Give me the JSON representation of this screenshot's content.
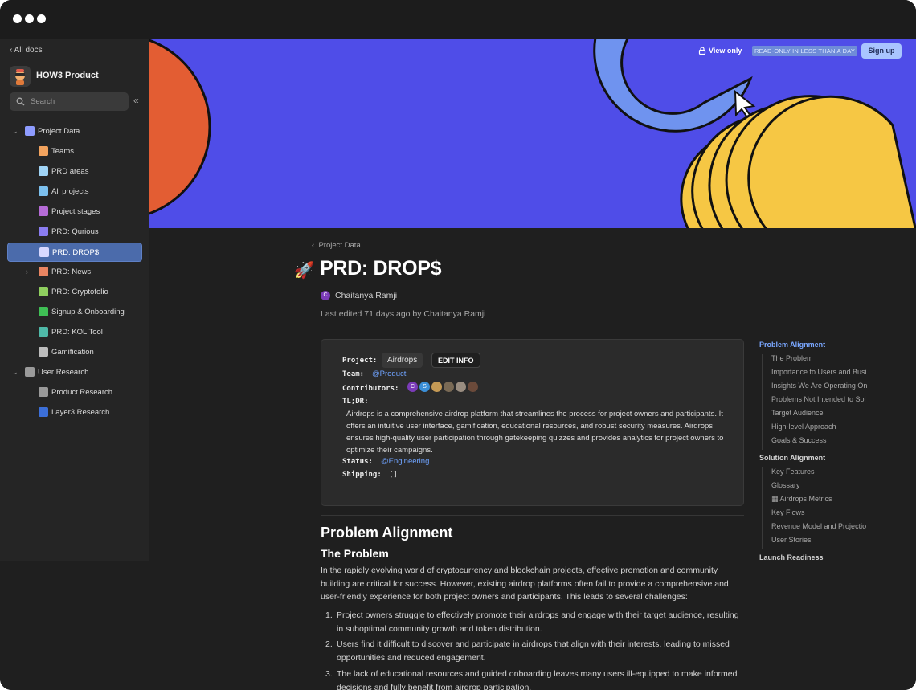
{
  "sidebar": {
    "back_label": "‹ All docs",
    "workspace_name": "HOW3 Product",
    "search_placeholder": "Search",
    "collapse_glyph": "«",
    "items": [
      {
        "label": "Project Data",
        "icon": "database-icon",
        "chev": "⌄",
        "level": 0,
        "color": "#8e9cff"
      },
      {
        "label": "Teams",
        "icon": "people-icon",
        "chev": "",
        "level": 1,
        "color": "#f2a35e"
      },
      {
        "label": "PRD areas",
        "icon": "document-icon",
        "chev": "",
        "level": 1,
        "color": "#9fd3f5"
      },
      {
        "label": "All projects",
        "icon": "folder-icon",
        "chev": "",
        "level": 1,
        "color": "#7cc0ee"
      },
      {
        "label": "Project stages",
        "icon": "stages-icon",
        "chev": "",
        "level": 1,
        "color": "#b56bd6"
      },
      {
        "label": "PRD: Qurious",
        "icon": "phone-icon",
        "chev": "",
        "level": 1,
        "color": "#8a7cf0"
      },
      {
        "label": "PRD: DROP$",
        "icon": "pen-icon",
        "chev": "",
        "level": 1,
        "color": "#d8d8ff"
      },
      {
        "label": "PRD: News",
        "icon": "newspaper-icon",
        "chev": "›",
        "level": 1,
        "color": "#e98562"
      },
      {
        "label": "PRD: Cryptofolio",
        "icon": "moneybag-icon",
        "chev": "",
        "level": 1,
        "color": "#8fcf5f"
      },
      {
        "label": "Signup & Onboarding",
        "icon": "check-icon",
        "chev": "",
        "level": 1,
        "color": "#3fbf55"
      },
      {
        "label": "PRD: KOL Tool",
        "icon": "globe-icon",
        "chev": "",
        "level": 1,
        "color": "#4fb9a8"
      },
      {
        "label": "Gamification",
        "icon": "gamepad-icon",
        "chev": "",
        "level": 1,
        "color": "#bdbdbd"
      },
      {
        "label": "User Research",
        "icon": "page-icon",
        "chev": "⌄",
        "level": 0,
        "color": "#9a9a9a"
      },
      {
        "label": "Product Research",
        "icon": "page-icon",
        "chev": "",
        "level": 1,
        "color": "#9a9a9a"
      },
      {
        "label": "Layer3 Research",
        "icon": "layer3-icon",
        "chev": "",
        "level": 1,
        "color": "#3c6fd8"
      }
    ]
  },
  "banner": {
    "view_only": "View only",
    "readonly_badge": "READ-ONLY IN LESS THAN A DAY",
    "signup_label": "Sign up"
  },
  "page": {
    "breadcrumb": "Project Data",
    "emoji": "🚀",
    "title": "PRD: DROP$",
    "author_initial": "C",
    "author": "Chaitanya Ramji",
    "last_edited": "Last edited 71 days ago by Chaitanya Ramji"
  },
  "info": {
    "project_key": "Project:",
    "project_value": "Airdrops",
    "edit_label": "EDIT INFO",
    "team_key": "Team:",
    "team_value": "@Product",
    "contributors_key": "Contributors:",
    "contributors": [
      {
        "initial": "C",
        "color": "#7b3bb8"
      },
      {
        "initial": "S",
        "color": "#3b8fd8"
      },
      {
        "initial": "",
        "color": "#c59a55"
      },
      {
        "initial": "",
        "color": "#7a6a55"
      },
      {
        "initial": "",
        "color": "#9a8d80"
      },
      {
        "initial": "",
        "color": "#6b4a3a"
      }
    ],
    "tldr_key": "TL;DR:",
    "tldr_text": "Airdrops is a comprehensive airdrop platform that streamlines the process for project owners and participants. It offers an intuitive user interface, gamification, educational resources, and robust security measures. Airdrops ensures high-quality user participation through gatekeeping quizzes and provides analytics for project owners to optimize their campaigns.",
    "status_key": "Status:",
    "status_value": "@Engineering",
    "shipping_key": "Shipping:",
    "shipping_value": "[]"
  },
  "content": {
    "h2": "Problem Alignment",
    "h3": "The Problem",
    "paragraph": "In the rapidly evolving world of cryptocurrency and blockchain projects, effective promotion and community building are critical for success. However, existing airdrop platforms often fail to provide a comprehensive and user-friendly experience for both project owners and participants. This leads to several challenges:",
    "list": [
      {
        "num": "1.",
        "text": "Project owners struggle to effectively promote their airdrops and engage with their target audience, resulting in suboptimal community growth and token distribution."
      },
      {
        "num": "2.",
        "text": "Users find it difficult to discover and participate in airdrops that align with their interests, leading to missed opportunities and reduced engagement."
      },
      {
        "num": "3.",
        "text": "The lack of educational resources and guided onboarding leaves many users ill-equipped to make informed decisions and fully benefit from airdrop participation."
      }
    ]
  },
  "toc": {
    "sections": [
      {
        "title": "Problem Alignment",
        "active": true,
        "items": [
          "The Problem",
          "Importance to Users and Busi",
          "Insights We Are Operating On",
          "Problems Not Intended to Sol",
          "Target Audience",
          "High-level Approach",
          "Goals & Success"
        ]
      },
      {
        "title": "Solution Alignment",
        "active": false,
        "items": [
          "Key Features",
          "Glossary",
          "▦ Airdrops Metrics",
          "Key Flows",
          "Revenue Model and Projectio",
          "User Stories"
        ]
      },
      {
        "title": "Launch Readiness",
        "active": false,
        "items": []
      }
    ]
  },
  "colors": {
    "banner_bg": "#4f4de8",
    "accent_link": "#6fa3ff",
    "active_item": "#4b6bab"
  }
}
